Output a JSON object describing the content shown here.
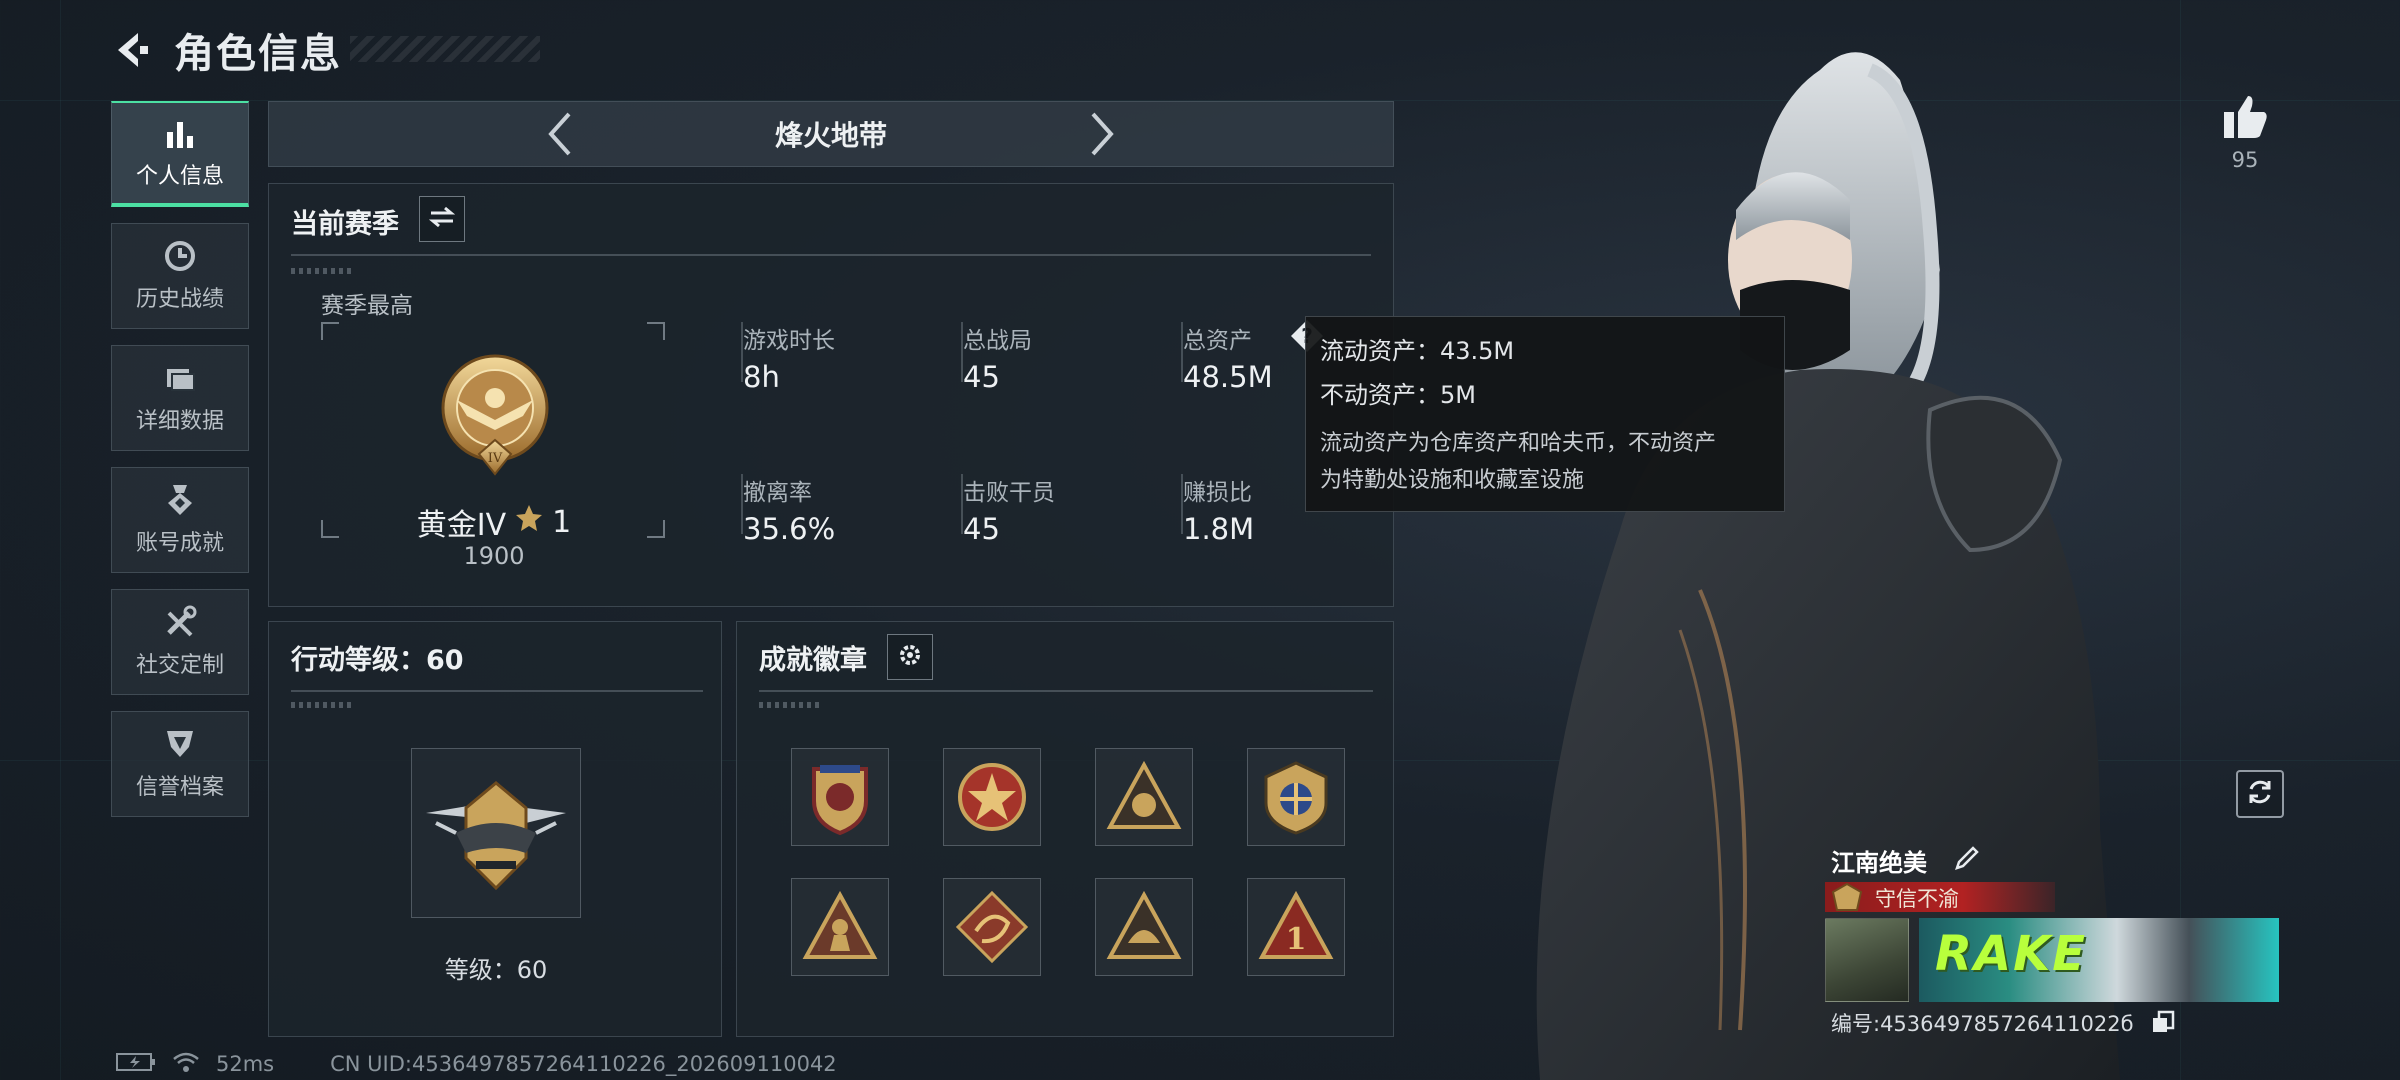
{
  "header": {
    "title": "角色信息"
  },
  "sidebar": {
    "items": [
      {
        "label": "个人信息",
        "icon": "bar-chart-icon",
        "active": true
      },
      {
        "label": "历史战绩",
        "icon": "clock-icon",
        "active": false
      },
      {
        "label": "详细数据",
        "icon": "folder-icon",
        "active": false
      },
      {
        "label": "账号成就",
        "icon": "medal-icon",
        "active": false
      },
      {
        "label": "社交定制",
        "icon": "tools-icon",
        "active": false
      },
      {
        "label": "信誉档案",
        "icon": "shield-icon",
        "active": false
      }
    ]
  },
  "mode": {
    "label": "烽火地带"
  },
  "season": {
    "title": "当前赛季",
    "best_label": "赛季最高",
    "rank_name": "黄金IV",
    "rank_stars": "1",
    "rank_score": "1900",
    "stats": [
      {
        "label": "游戏时长",
        "value": "8h"
      },
      {
        "label": "总战局",
        "value": "45"
      },
      {
        "label": "总资产",
        "value": "48.5M"
      },
      {
        "label": "撤离率",
        "value": "35.6%"
      },
      {
        "label": "击败干员",
        "value": "45"
      },
      {
        "label": "赚损比",
        "value": "1.8M"
      }
    ]
  },
  "tooltip": {
    "liquid": "流动资产：43.5M",
    "fixed": "不动资产：5M",
    "desc_line1": "流动资产为仓库资产和哈夫币，不动资产",
    "desc_line2": "为特勤处设施和收藏室设施"
  },
  "action_level": {
    "title": "行动等级：60",
    "level_text": "等级：60"
  },
  "achievements": {
    "title": "成就徽章",
    "badges": [
      "badge-shield",
      "badge-star",
      "badge-triangle",
      "badge-wings",
      "badge-soldier",
      "badge-dragon",
      "badge-helmet",
      "badge-one"
    ]
  },
  "likes": {
    "count": "95"
  },
  "profile": {
    "name": "江南绝美",
    "motto": "守信不渝",
    "banner_text": "RAKE",
    "id_text": "编号:453649785726411022б"
  },
  "status": {
    "ping": "52ms",
    "uid": "CN UID:4536497857264110226_202609110042"
  },
  "colors": {
    "accent": "#4ce0a3",
    "motto_red": "#b22222",
    "gold": "#c9a45c"
  }
}
